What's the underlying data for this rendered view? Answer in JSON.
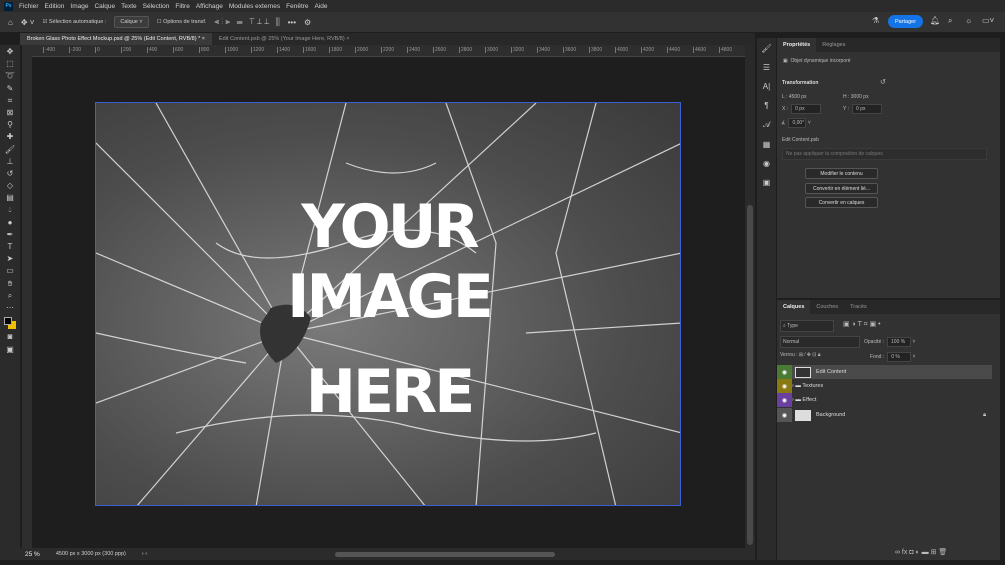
{
  "menubar": {
    "logo": "Ps",
    "items": [
      "Fichier",
      "Edition",
      "Image",
      "Calque",
      "Texte",
      "Sélection",
      "Filtre",
      "Affichage",
      "Modules externes",
      "Fenêtre",
      "Aide"
    ]
  },
  "options": {
    "auto_select": "Sélection automatique :",
    "auto_select_checked": true,
    "target": "Calque",
    "transform_options": "Options de transf.",
    "share": "Partager"
  },
  "tabs": [
    {
      "label": "Broken Glass Photo Effect Mockup.psd @ 25% (Edit Content, RVB/8) *",
      "active": true
    },
    {
      "label": "Edit Content.psb @ 25% (Your Image Here, RVB/8)",
      "active": false
    }
  ],
  "ruler_ticks": [
    "-400",
    "-200",
    "0",
    "200",
    "400",
    "600",
    "800",
    "1000",
    "1200",
    "1400",
    "1600",
    "1800",
    "2000",
    "2200",
    "2400",
    "2600",
    "2800",
    "3000",
    "3200",
    "3400",
    "3600",
    "3800",
    "4000",
    "4200",
    "4400",
    "4600",
    "4800"
  ],
  "canvas": {
    "text_lines": [
      "YOUR",
      "IMAGE",
      "HERE"
    ]
  },
  "status": {
    "zoom": "25 %",
    "doc_info": "4500 px x 3000 px (300 ppp)"
  },
  "properties": {
    "tabs": [
      "Propriétés",
      "Réglages"
    ],
    "object_type": "Objet dynamique incorporé",
    "section": "Transformation",
    "w_label": "L :",
    "w_value": "4500 px",
    "h_label": "H :",
    "h_value": "3000 px",
    "x_label": "X :",
    "x_value": "0 px",
    "y_label": "Y :",
    "y_value": "0 px",
    "angle": "0,00°",
    "file": "Edit Content.psb",
    "comp": "Ne pas appliquer la composition de calques",
    "buttons": [
      "Modifier le contenu",
      "Convertir en élément lié...",
      "Convertir en calques"
    ]
  },
  "layers": {
    "tabs": [
      "Calques",
      "Couches",
      "Tracés"
    ],
    "filter": "Type",
    "blend": "Normal",
    "opacity_label": "Opacité :",
    "opacity": "100 %",
    "lock_label": "Verrou :",
    "fill_label": "Fond :",
    "fill": "0 %",
    "items": [
      {
        "name": "Edit Content",
        "color": "#4b7a34",
        "selected": true
      },
      {
        "name": "Textures",
        "color": "#8a7a12",
        "group": true
      },
      {
        "name": "Effect",
        "color": "#6a3fa0",
        "group": true
      },
      {
        "name": "Background",
        "color": "#555555",
        "locked": true
      }
    ]
  },
  "colors": {
    "accent": "#1473e6",
    "selection_border": "#3b5fd0",
    "foreground": "#000000",
    "background": "#f0c000"
  }
}
